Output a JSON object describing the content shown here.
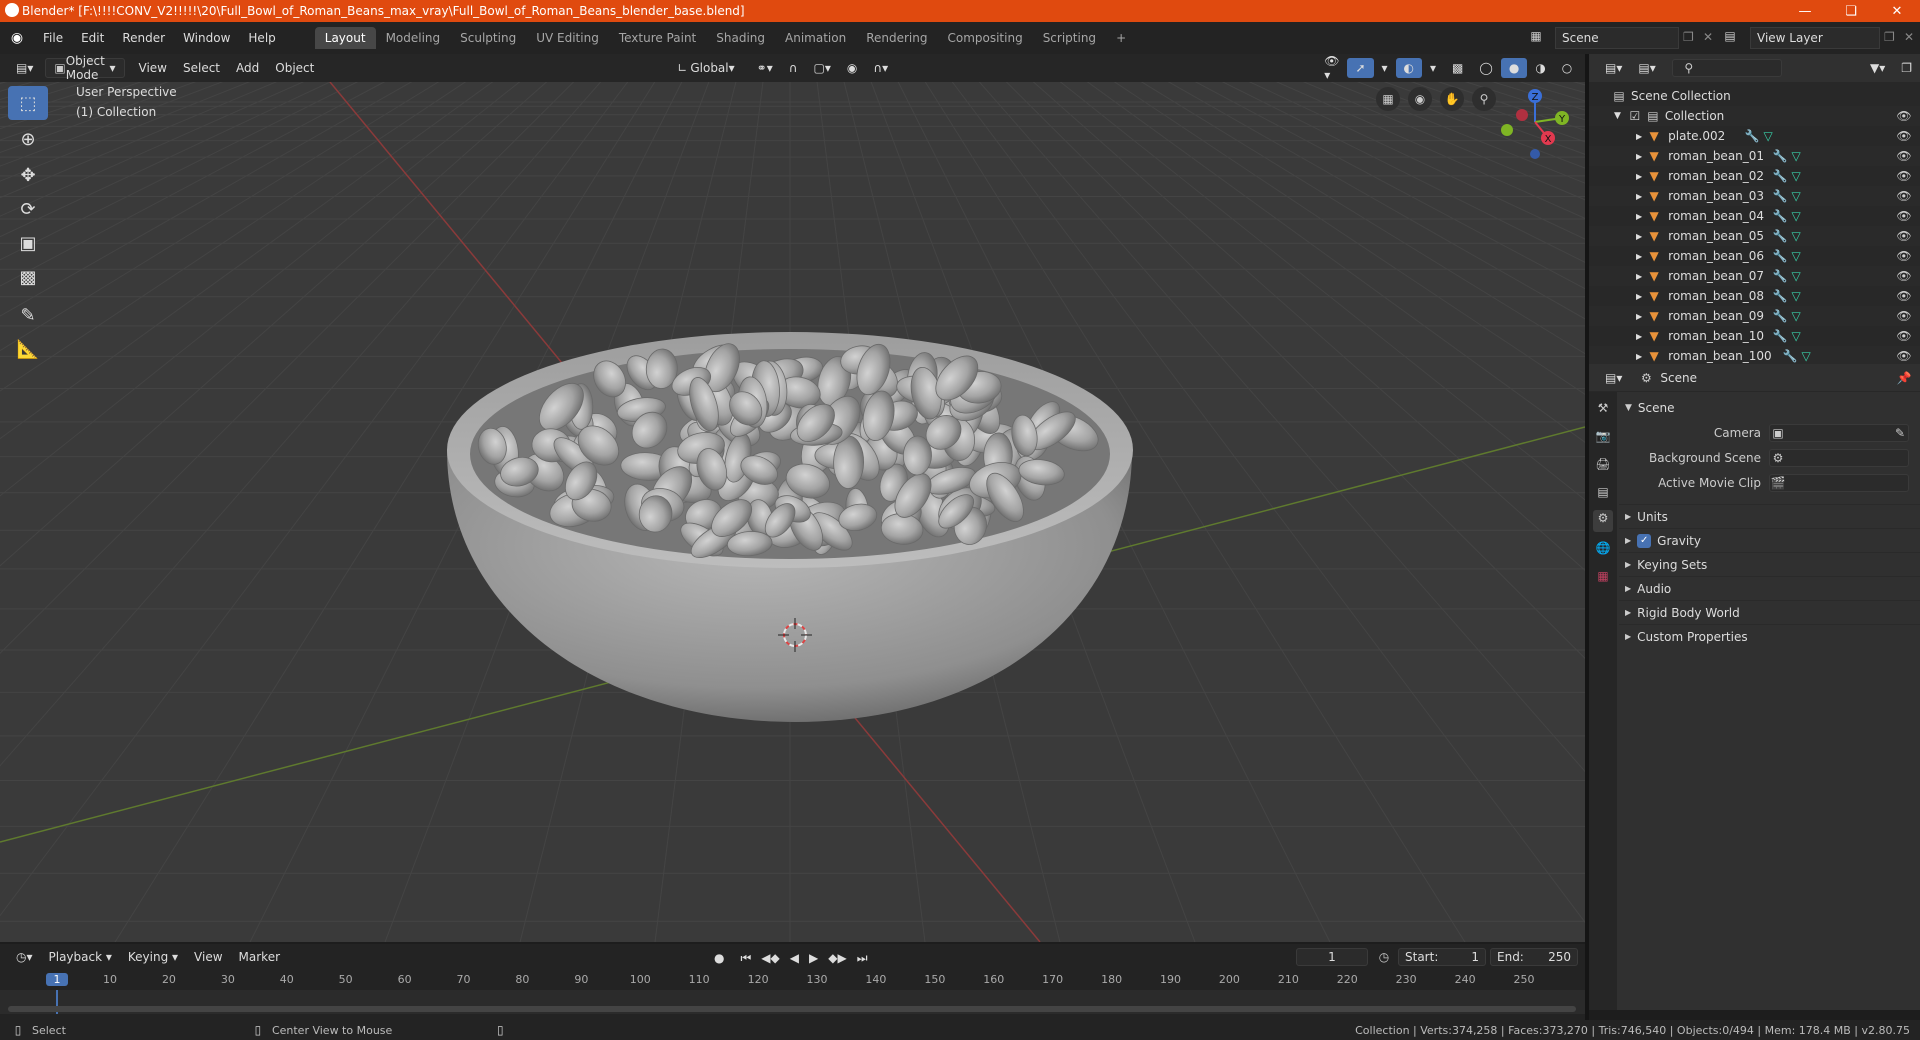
{
  "window": {
    "title": "Blender* [F:\\!!!!CONV_V2!!!!!\\20\\Full_Bowl_of_Roman_Beans_max_vray\\Full_Bowl_of_Roman_Beans_blender_base.blend]",
    "accent": "#e04a0f"
  },
  "menu": [
    "File",
    "Edit",
    "Render",
    "Window",
    "Help"
  ],
  "workspaces": [
    "Layout",
    "Modeling",
    "Sculpting",
    "UV Editing",
    "Texture Paint",
    "Shading",
    "Animation",
    "Rendering",
    "Compositing",
    "Scripting"
  ],
  "scene_selector": {
    "value": "Scene"
  },
  "view_layer_selector": {
    "value": "View Layer"
  },
  "viewport_header": {
    "mode": "Object Mode",
    "menus": [
      "View",
      "Select",
      "Add",
      "Object"
    ],
    "orientation": "Global"
  },
  "viewport": {
    "perspective_label": "User Perspective",
    "collection_label": "(1) Collection",
    "gizmo": {
      "z": "Z",
      "y": "Y",
      "x": "X"
    }
  },
  "outliner": {
    "root": "Scene Collection",
    "collection": "Collection",
    "items": [
      "plate.002",
      "roman_bean_01",
      "roman_bean_02",
      "roman_bean_03",
      "roman_bean_04",
      "roman_bean_05",
      "roman_bean_06",
      "roman_bean_07",
      "roman_bean_08",
      "roman_bean_09",
      "roman_bean_10",
      "roman_bean_100"
    ]
  },
  "properties": {
    "breadcrumb": "Scene",
    "panel_title": "Scene",
    "fields": [
      {
        "label": "Camera"
      },
      {
        "label": "Background Scene"
      },
      {
        "label": "Active Movie Clip"
      }
    ],
    "sections": [
      "Units",
      "Gravity",
      "Keying Sets",
      "Audio",
      "Rigid Body World",
      "Custom Properties"
    ]
  },
  "timeline": {
    "menus": [
      "Playback",
      "Keying",
      "View",
      "Marker"
    ],
    "current_frame": "1",
    "start_label": "Start:",
    "start": "1",
    "end_label": "End:",
    "end": "250",
    "ruler": [
      "1",
      "10",
      "20",
      "30",
      "40",
      "50",
      "60",
      "70",
      "80",
      "90",
      "100",
      "110",
      "120",
      "130",
      "140",
      "150",
      "160",
      "170",
      "180",
      "190",
      "200",
      "210",
      "220",
      "230",
      "240",
      "250"
    ]
  },
  "status": {
    "left_action": "Select",
    "middle_action": "Center View to Mouse",
    "stats": "Collection | Verts:374,258 | Faces:373,270 | Tris:746,540 | Objects:0/494 | Mem: 178.4 MB | v2.80.75"
  }
}
